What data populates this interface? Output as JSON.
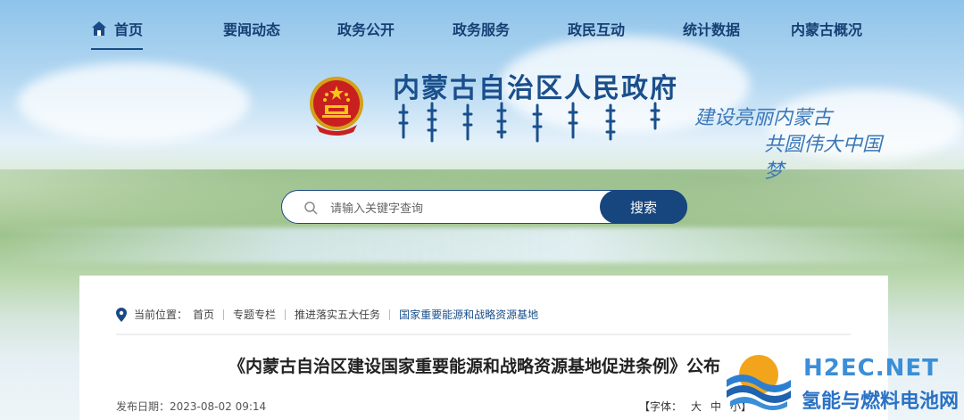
{
  "nav": {
    "items": [
      {
        "label": "首页",
        "icon": "home-icon",
        "active": true
      },
      {
        "label": "要闻动态"
      },
      {
        "label": "政务公开"
      },
      {
        "label": "政务服务"
      },
      {
        "label": "政民互动"
      },
      {
        "label": "统计数据"
      },
      {
        "label": "内蒙古概况"
      }
    ]
  },
  "header": {
    "title": "内蒙古自治区人民政府",
    "slogan_line1": "建设亮丽内蒙古",
    "slogan_line2": "共圆伟大中国梦",
    "emblem_icon": "national-emblem-icon"
  },
  "search": {
    "placeholder": "请输入关键字查询",
    "button_label": "搜索",
    "icon": "search-icon"
  },
  "breadcrumb": {
    "prefix": "当前位置：",
    "items": [
      "首页",
      "专题专栏",
      "推进落实五大任务",
      "国家重要能源和战略资源基地"
    ],
    "icon": "location-pin-icon"
  },
  "article": {
    "title": "《内蒙古自治区建设国家重要能源和战略资源基地促进条例》公布",
    "publish_label": "发布日期：",
    "publish_date": "2023-08-02 09:14",
    "font_label": "【字体：",
    "font_large": "大",
    "font_medium": "中",
    "font_small": "小】"
  },
  "watermark": {
    "brand": "H2EC.NET",
    "subtitle": "氢能与燃料电池网"
  },
  "colors": {
    "primary": "#17457e",
    "title": "#1a4f8c",
    "slogan": "#3b78b8",
    "watermark": "#3b8ed8"
  }
}
